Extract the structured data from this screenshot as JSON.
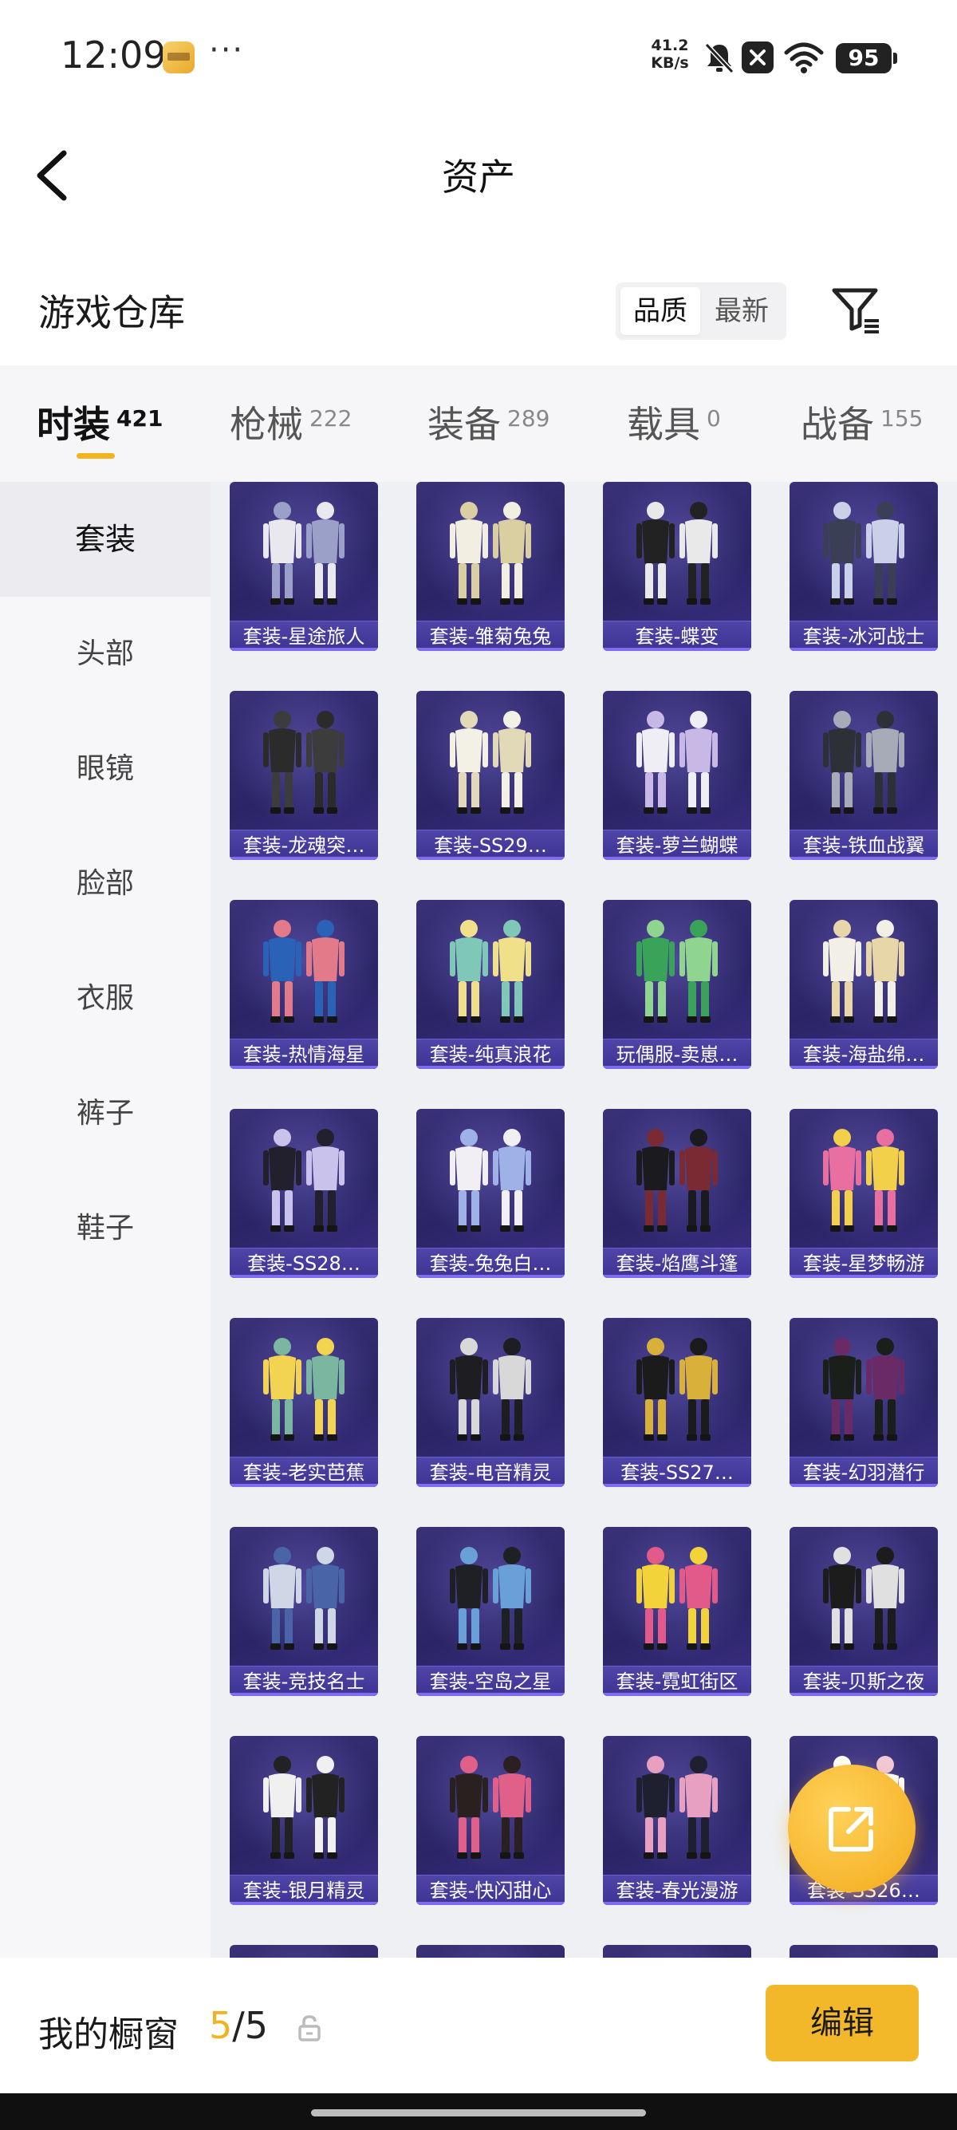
{
  "status_bar": {
    "time": "12:09",
    "overflow": "···",
    "speed_value": "41.2",
    "speed_unit": "KB/s",
    "battery": "95",
    "icons": [
      "app-icon",
      "mute-bell-icon",
      "close-box-icon",
      "wifi-icon",
      "battery-icon"
    ]
  },
  "nav": {
    "title": "资产",
    "back_icon": "chevron-left-icon"
  },
  "section": {
    "title": "游戏仓库",
    "sort_options": [
      "品质",
      "最新"
    ],
    "sort_selected": "品质",
    "filter_icon": "filter-icon"
  },
  "tabs": [
    {
      "label": "时装",
      "count": "421",
      "active": true
    },
    {
      "label": "枪械",
      "count": "222"
    },
    {
      "label": "装备",
      "count": "289"
    },
    {
      "label": "载具",
      "count": "0"
    },
    {
      "label": "战备",
      "count": "155"
    }
  ],
  "sidebar": {
    "items": [
      "套装",
      "头部",
      "眼镜",
      "脸部",
      "衣服",
      "裤子",
      "鞋子"
    ],
    "selected": "套装"
  },
  "grid": {
    "items": [
      "套装-星途旅人",
      "套装-雏菊兔兔",
      "套装-蝶变",
      "套装-冰河战士",
      "套装-龙魂突…",
      "套装-SS29…",
      "套装-萝兰蝴蝶",
      "套装-铁血战翼",
      "套装-热情海星",
      "套装-纯真浪花",
      "玩偶服-卖崽…",
      "套装-海盐绵…",
      "套装-SS28…",
      "套装-兔兔白…",
      "套装-焰鹰斗篷",
      "套装-星梦畅游",
      "套装-老实芭蕉",
      "套装-电音精灵",
      "套装-SS27…",
      "套装-幻羽潜行",
      "套装-竞技名士",
      "套装-空岛之星",
      "套装-霓虹街区",
      "套装-贝斯之夜",
      "套装-银月精灵",
      "套装-快闪甜心",
      "套装-春光漫游",
      "套装-SS26…"
    ],
    "partial_row_count": 4
  },
  "fab": {
    "icon": "share-external-icon"
  },
  "bottom_bar": {
    "label": "我的橱窗",
    "current": "5",
    "separator": "/",
    "total": "5",
    "lock_icon": "lock-icon",
    "edit_button": "编辑"
  },
  "colors": {
    "accent": "#f2b31f",
    "card_bg": "#2f2870",
    "card_label": "#4a3fa2",
    "page_bg": "#ffffff",
    "grid_bg": "#eef0f4"
  }
}
